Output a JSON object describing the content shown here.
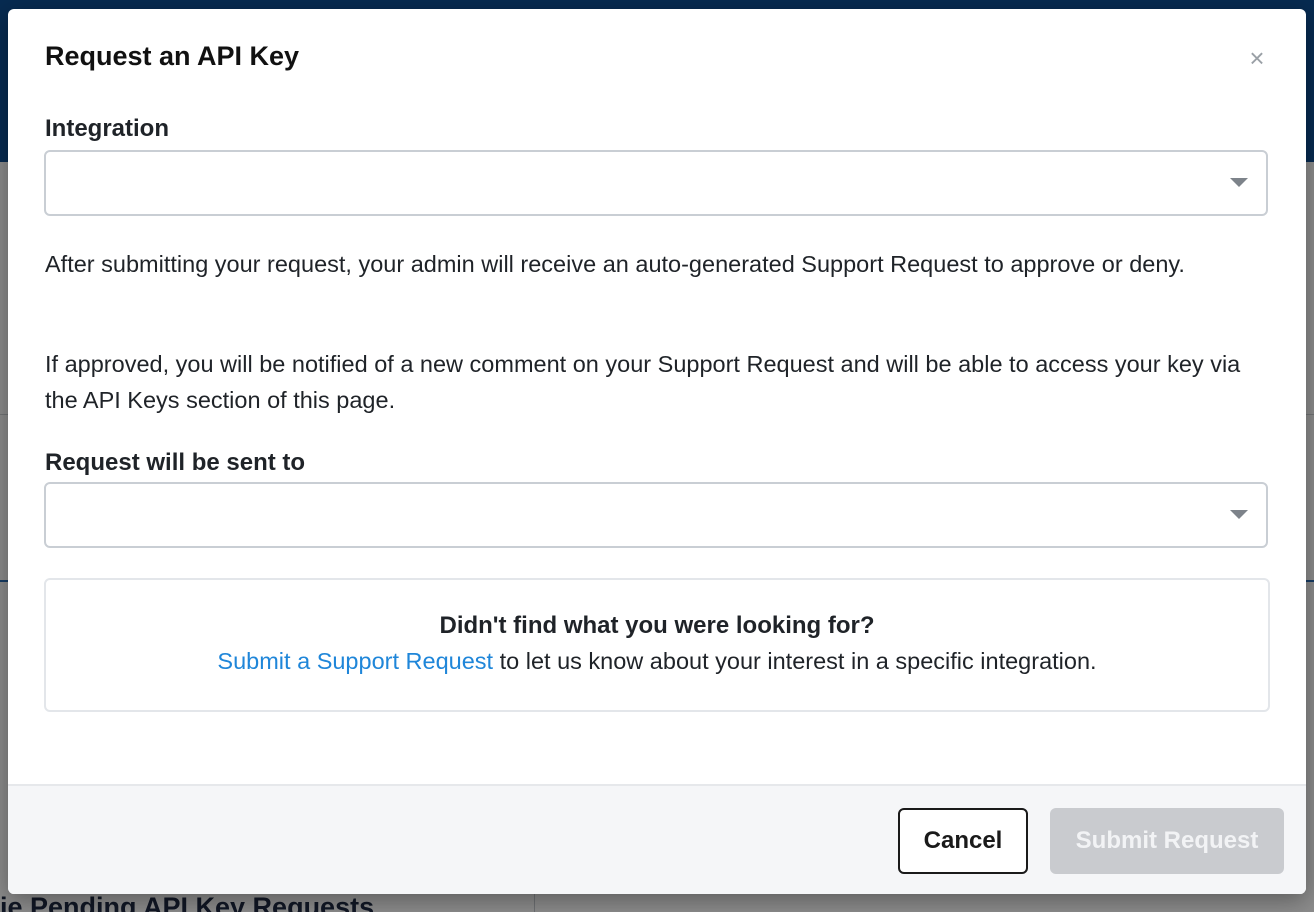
{
  "modal": {
    "title": "Request an API Key",
    "close_symbol": "×",
    "integration": {
      "label": "Integration",
      "value": ""
    },
    "paragraph_1": "After submitting your request, your admin will receive an auto-generated Support Request to approve or deny.",
    "paragraph_2": "If approved, you will be notified of a new comment on your Support Request and will be able to access your key via the API Keys section of this page.",
    "recipient": {
      "label": "Request will be sent to",
      "value": ""
    },
    "info_box": {
      "title": "Didn't find what you were looking for?",
      "link_text": "Submit a Support Request",
      "trailing_text": " to let us know about your interest in a specific integration."
    },
    "buttons": {
      "cancel": "Cancel",
      "submit": "Submit Request"
    }
  },
  "background": {
    "bottom_heading": "ie Pending API Key Requests"
  },
  "colors": {
    "header_blue": "#0d4f94",
    "link_blue": "#1f86d9",
    "disabled_button": "#c9cbcf"
  }
}
